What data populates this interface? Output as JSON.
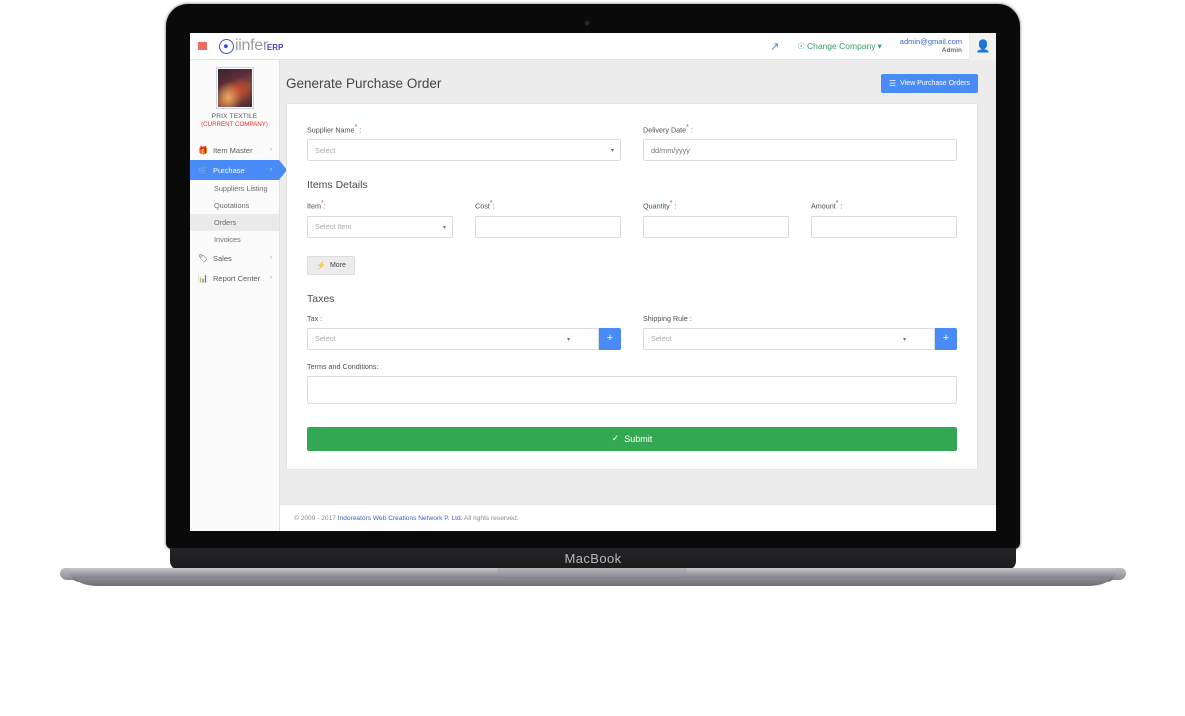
{
  "device": {
    "model_label": "MacBook"
  },
  "header": {
    "menu_icon": "hamburger-icon",
    "brand_name": "iinfer",
    "brand_suffix": "ERP",
    "expand_icon": "expand-arrows-icon",
    "change_company_label": "Change Company",
    "change_company_icon": "globe-icon",
    "change_company_caret": "▾",
    "user_email": "admin@gmail.com",
    "user_role": "Admin",
    "avatar_icon": "user-icon"
  },
  "sidebar": {
    "company_name": "PRIX TEXTILE",
    "company_status": "(CURRENT COMPANY)",
    "company_logo_alt": "company-logo-thumbnail",
    "items": [
      {
        "label": "Item Master",
        "icon": "gift-icon",
        "caret": "›",
        "active": false
      },
      {
        "label": "Purchase",
        "icon": "cart-icon",
        "caret": "›",
        "active": true
      }
    ],
    "sub_items": [
      {
        "label": "Suppliers Listing",
        "selected": false
      },
      {
        "label": "Quotations",
        "selected": false
      },
      {
        "label": "Orders",
        "selected": true
      },
      {
        "label": "Invoices",
        "selected": false
      }
    ],
    "items_after": [
      {
        "label": "Sales",
        "icon": "tag-icon",
        "caret": "›",
        "active": false
      },
      {
        "label": "Report Center",
        "icon": "chart-icon",
        "caret": "›",
        "active": false
      }
    ]
  },
  "content": {
    "page_title": "Generate Purchase Order",
    "view_orders_button": "View Purchase Orders",
    "view_orders_icon": "list-icon",
    "form": {
      "supplier_name_label": "Supplier Name",
      "supplier_name_value": "Select",
      "delivery_date_label": "Delivery Date",
      "delivery_date_placeholder": "dd/mm/yyyy",
      "items_details_title": "Items Details",
      "item_label": "Item",
      "item_value": "Select Item",
      "cost_label": "Cost",
      "cost_value": "",
      "quantity_label": "Quantity",
      "quantity_value": "",
      "amount_label": "Amount",
      "amount_value": "",
      "more_button": "More",
      "more_icon": "bolt-icon",
      "taxes_title": "Taxes",
      "tax_label": "Tax :",
      "tax_value": "Select",
      "tax_add_icon": "plus-icon",
      "shipping_rule_label": "Shipping Rule :",
      "shipping_rule_value": "Select",
      "shipping_add_icon": "plus-icon",
      "terms_label": "Terms and Conditions:",
      "terms_value": "",
      "submit_label": "Submit",
      "submit_icon": "check-icon",
      "required_marker": "*",
      "colon": ":",
      "select_caret": "▾"
    }
  },
  "footer": {
    "copyright_prefix": "© 2009 - 2017 ",
    "company_link": "Indoreators Web Creations Network P. Ltd.",
    "suffix": " All rights reserved."
  },
  "colors": {
    "primary_blue": "#4a8cf7",
    "submit_green": "#33a852",
    "required_red": "#e23b2e",
    "link_blue": "#4062c4",
    "change_company_green": "#35a06a"
  }
}
